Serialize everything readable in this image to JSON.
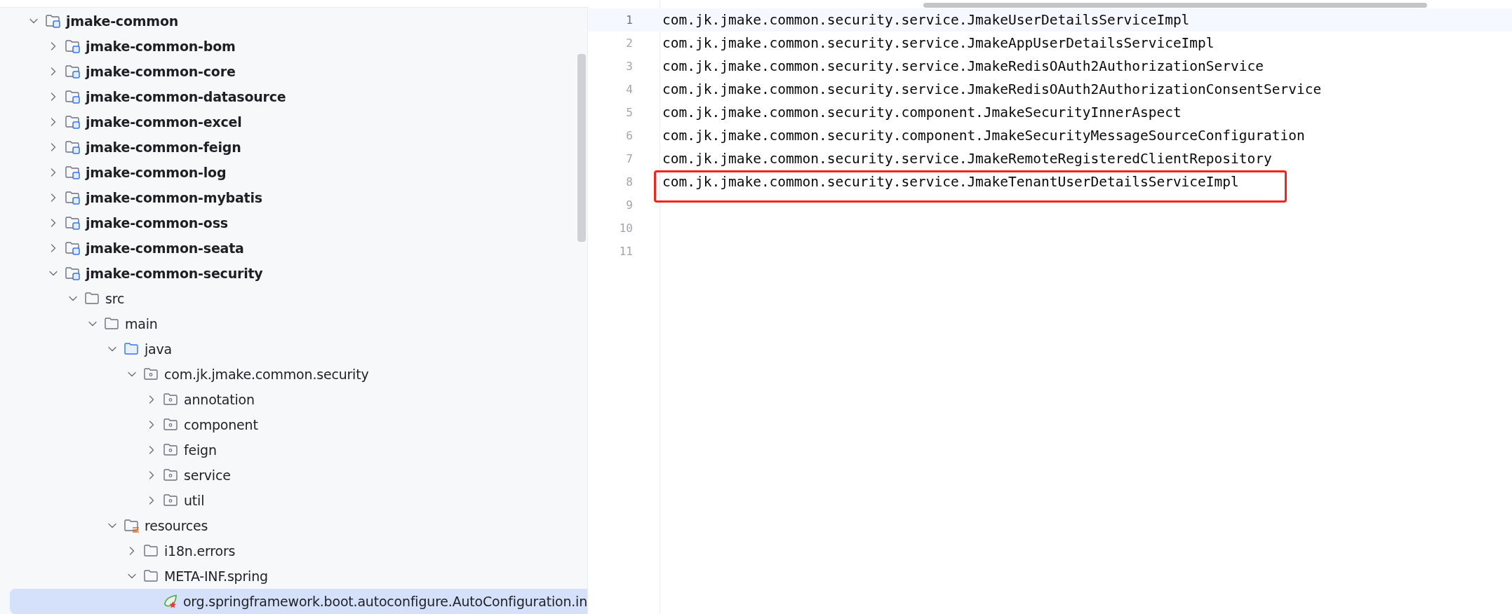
{
  "project_tree": [
    {
      "label": "jmake-common",
      "kind": "module",
      "expanded": true,
      "selected": false,
      "children": [
        {
          "label": "jmake-common-bom",
          "kind": "module",
          "expanded": false,
          "selected": false
        },
        {
          "label": "jmake-common-core",
          "kind": "module",
          "expanded": false,
          "selected": false
        },
        {
          "label": "jmake-common-datasource",
          "kind": "module",
          "expanded": false,
          "selected": false
        },
        {
          "label": "jmake-common-excel",
          "kind": "module",
          "expanded": false,
          "selected": false
        },
        {
          "label": "jmake-common-feign",
          "kind": "module",
          "expanded": false,
          "selected": false
        },
        {
          "label": "jmake-common-log",
          "kind": "module",
          "expanded": false,
          "selected": false
        },
        {
          "label": "jmake-common-mybatis",
          "kind": "module",
          "expanded": false,
          "selected": false
        },
        {
          "label": "jmake-common-oss",
          "kind": "module",
          "expanded": false,
          "selected": false
        },
        {
          "label": "jmake-common-seata",
          "kind": "module",
          "expanded": false,
          "selected": false
        },
        {
          "label": "jmake-common-security",
          "kind": "module",
          "expanded": true,
          "selected": false,
          "children": [
            {
              "label": "src",
              "kind": "folder",
              "expanded": true,
              "selected": false,
              "children": [
                {
                  "label": "main",
                  "kind": "folder",
                  "expanded": true,
                  "selected": false,
                  "children": [
                    {
                      "label": "java",
                      "kind": "source",
                      "expanded": true,
                      "selected": false,
                      "children": [
                        {
                          "label": "com.jk.jmake.common.security",
                          "kind": "package",
                          "expanded": true,
                          "selected": false,
                          "children": [
                            {
                              "label": "annotation",
                              "kind": "package",
                              "expanded": false,
                              "selected": false
                            },
                            {
                              "label": "component",
                              "kind": "package",
                              "expanded": false,
                              "selected": false
                            },
                            {
                              "label": "feign",
                              "kind": "package",
                              "expanded": false,
                              "selected": false
                            },
                            {
                              "label": "service",
                              "kind": "package",
                              "expanded": false,
                              "selected": false
                            },
                            {
                              "label": "util",
                              "kind": "package",
                              "expanded": false,
                              "selected": false
                            }
                          ]
                        }
                      ]
                    },
                    {
                      "label": "resources",
                      "kind": "resources",
                      "expanded": true,
                      "selected": false,
                      "children": [
                        {
                          "label": "i18n.errors",
                          "kind": "folder",
                          "expanded": false,
                          "selected": false
                        },
                        {
                          "label": "META-INF.spring",
                          "kind": "folder",
                          "expanded": true,
                          "selected": false,
                          "children": [
                            {
                              "label": "org.springframework.boot.autoconfigure.AutoConfiguration.in",
                              "kind": "file",
                              "selected": true
                            }
                          ]
                        }
                      ]
                    }
                  ]
                }
              ]
            }
          ]
        }
      ]
    }
  ],
  "editor": {
    "lines": [
      {
        "number": "1",
        "text": "com.jk.jmake.common.security.service.JmakeUserDetailsServiceImpl",
        "current": true,
        "boxed": false
      },
      {
        "number": "2",
        "text": "com.jk.jmake.common.security.service.JmakeAppUserDetailsServiceImpl",
        "current": false,
        "boxed": false
      },
      {
        "number": "3",
        "text": "com.jk.jmake.common.security.service.JmakeRedisOAuth2AuthorizationService",
        "current": false,
        "boxed": false
      },
      {
        "number": "4",
        "text": "com.jk.jmake.common.security.service.JmakeRedisOAuth2AuthorizationConsentService",
        "current": false,
        "boxed": false
      },
      {
        "number": "5",
        "text": "com.jk.jmake.common.security.component.JmakeSecurityInnerAspect",
        "current": false,
        "boxed": false
      },
      {
        "number": "6",
        "text": "com.jk.jmake.common.security.component.JmakeSecurityMessageSourceConfiguration",
        "current": false,
        "boxed": false
      },
      {
        "number": "7",
        "text": "com.jk.jmake.common.security.service.JmakeRemoteRegisteredClientRepository",
        "current": false,
        "boxed": false
      },
      {
        "number": "8",
        "text": "com.jk.jmake.common.security.service.JmakeTenantUserDetailsServiceImpl",
        "current": false,
        "boxed": true
      },
      {
        "number": "9",
        "current": false,
        "boxed": false
      },
      {
        "number": "10",
        "current": false,
        "boxed": false
      },
      {
        "number": "11",
        "current": false,
        "boxed": false
      }
    ]
  }
}
